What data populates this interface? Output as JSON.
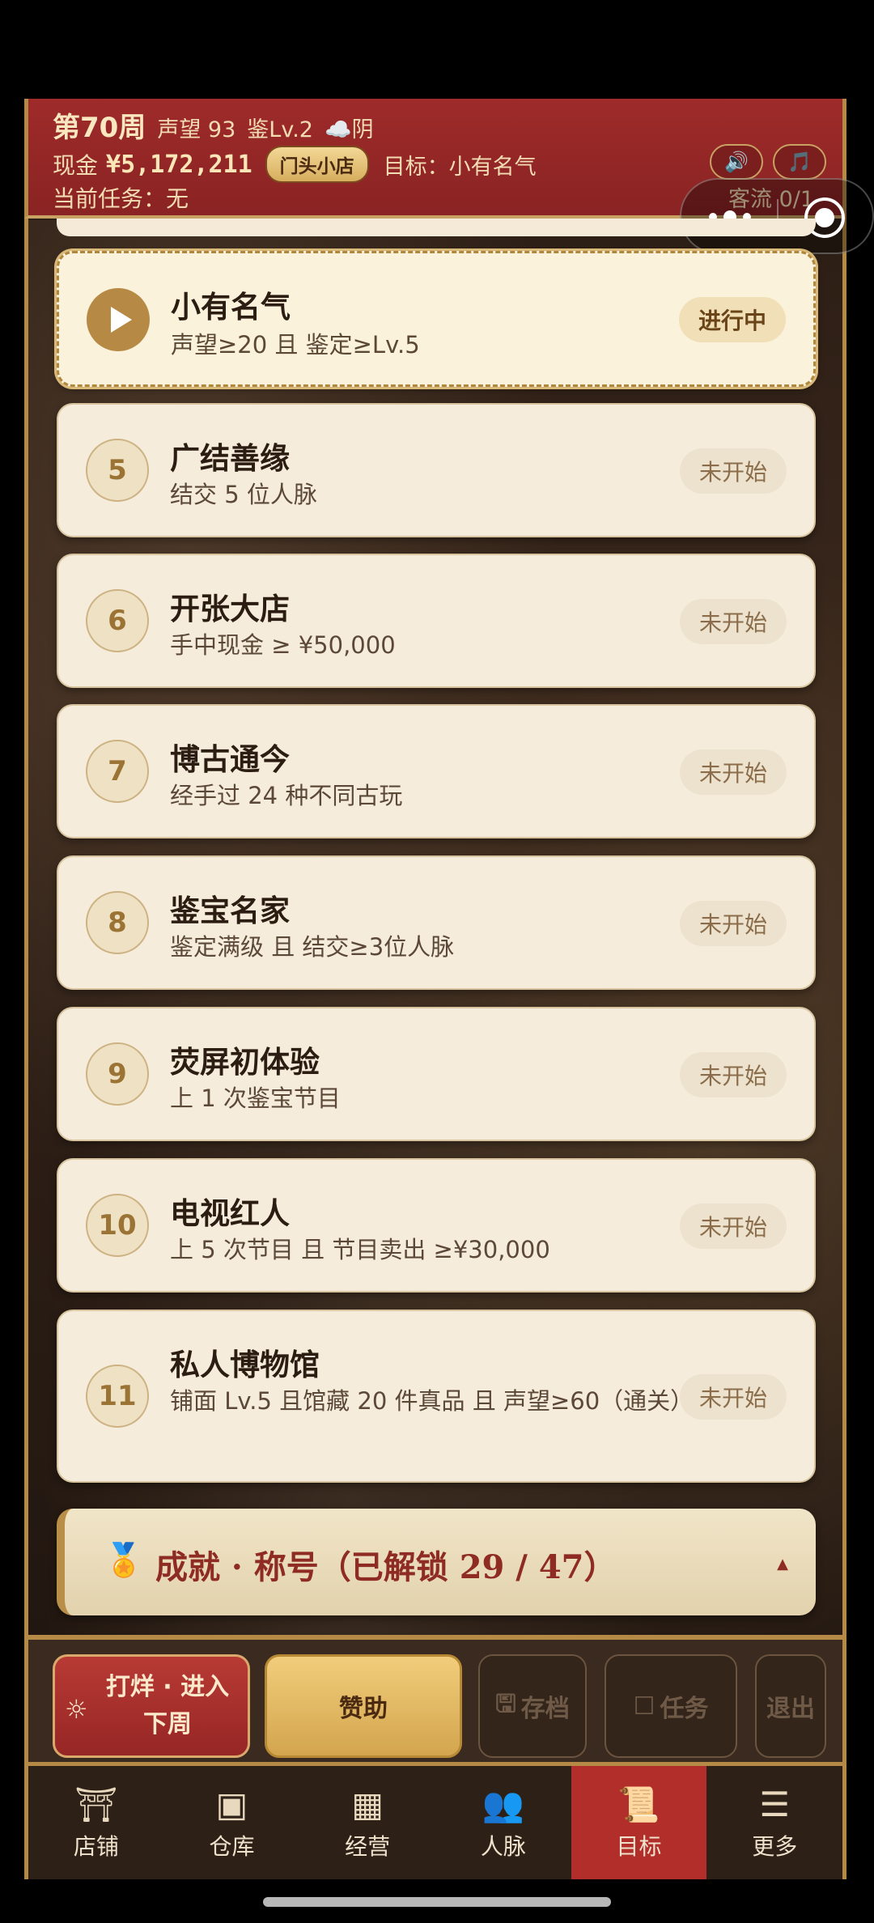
{
  "header": {
    "week": "第70周",
    "reputation": "声望 93",
    "appraisal": "鉴Lv.2",
    "weather": "☁️阴",
    "cash_label": "现金",
    "cash_value": "¥5,172,211",
    "shop_level": "门头小店",
    "target": "目标：小有名气",
    "current_task": "当前任务：无",
    "traffic": "客流 0/1",
    "sound_icon": "speaker-icon",
    "music_icon": "music-note-icon"
  },
  "goals": [
    {
      "badge": "play",
      "title": "小有名气",
      "desc": "声望≥20 且 鉴定≥Lv.5",
      "status": "进行中"
    },
    {
      "badge": "5",
      "title": "广结善缘",
      "desc": "结交 5 位人脉",
      "status": "未开始"
    },
    {
      "badge": "6",
      "title": "开张大店",
      "desc": "手中现金 ≥ ¥50,000",
      "status": "未开始"
    },
    {
      "badge": "7",
      "title": "博古通今",
      "desc": "经手过 24 种不同古玩",
      "status": "未开始"
    },
    {
      "badge": "8",
      "title": "鉴宝名家",
      "desc": "鉴定满级 且 结交≥3位人脉",
      "status": "未开始"
    },
    {
      "badge": "9",
      "title": "荧屏初体验",
      "desc": "上 1 次鉴宝节目",
      "status": "未开始"
    },
    {
      "badge": "10",
      "title": "电视红人",
      "desc": "上 5 次节目 且 节目卖出 ≥¥30,000",
      "status": "未开始"
    },
    {
      "badge": "11",
      "title": "私人博物馆",
      "desc": "铺面 Lv.5 且馆藏 20 件真品 且 声望≥60（通关）",
      "status": "未开始"
    }
  ],
  "achievement": {
    "text": "成就 · 称号（已解锁 29 / 47）",
    "medal_icon": "medal-icon",
    "arrow": "▲"
  },
  "actions": {
    "next_week": "打烊 · 进入下周",
    "sponsor": "赞助",
    "save": "存档",
    "task": "任务",
    "exit": "退出"
  },
  "tabs": [
    {
      "label": "店铺",
      "icon": "shop-icon",
      "active": false
    },
    {
      "label": "仓库",
      "icon": "chest-icon",
      "active": false
    },
    {
      "label": "经营",
      "icon": "abacus-icon",
      "active": false
    },
    {
      "label": "人脉",
      "icon": "people-icon",
      "active": false
    },
    {
      "label": "目标",
      "icon": "scroll-icon",
      "active": true
    },
    {
      "label": "更多",
      "icon": "stack-icon",
      "active": false
    }
  ]
}
